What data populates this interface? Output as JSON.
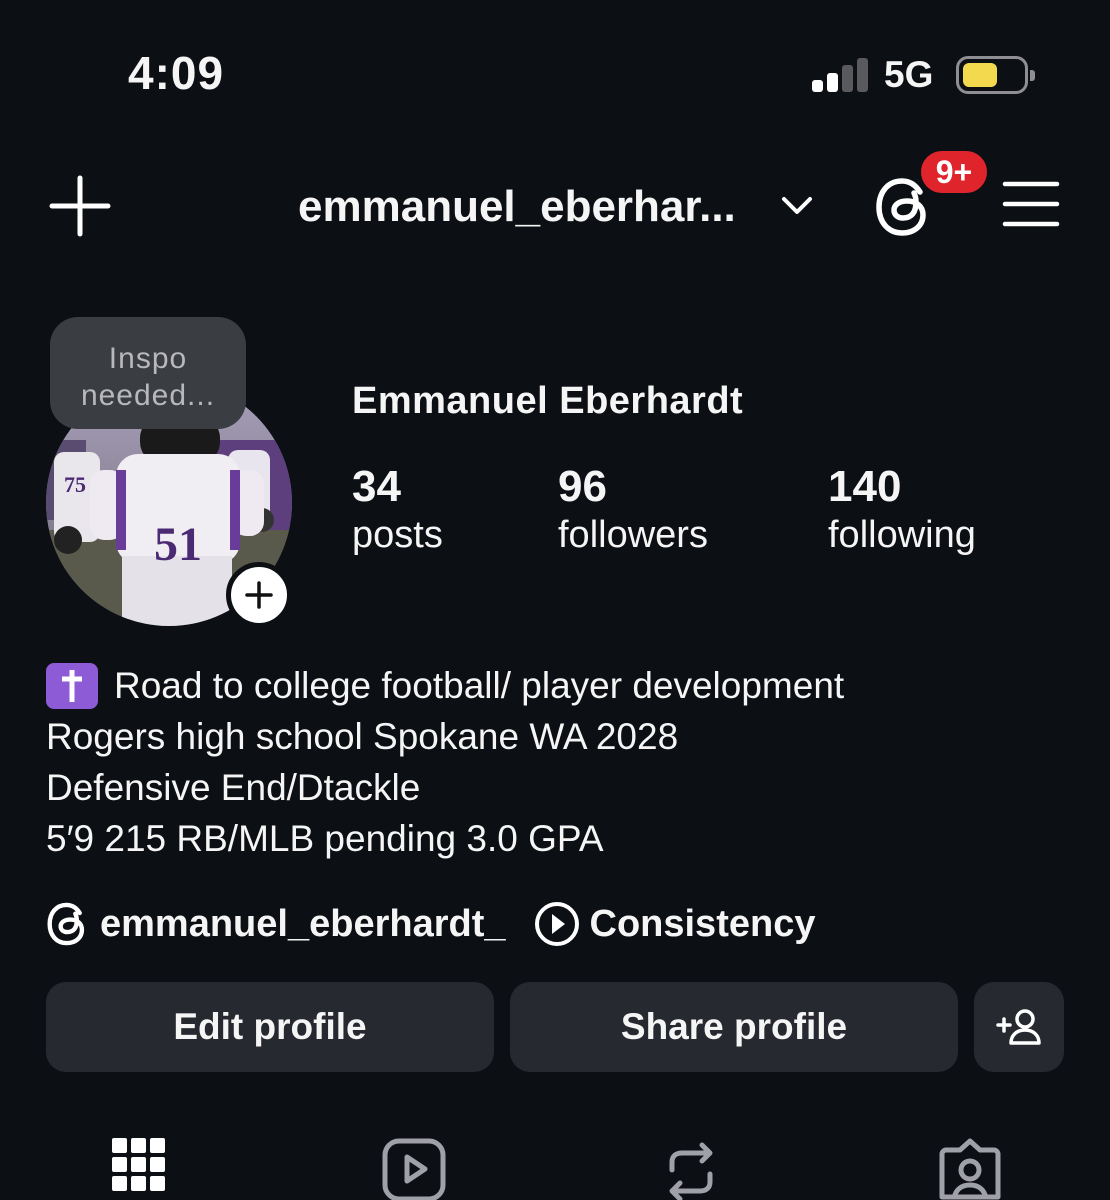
{
  "status_bar": {
    "time": "4:09",
    "network": "5G"
  },
  "header": {
    "username": "emmanuel_eberhar...",
    "notification_badge": "9+"
  },
  "profile": {
    "note": "Inspo needed...",
    "display_name": "Emmanuel Eberhardt",
    "stats": [
      {
        "count": "34",
        "label": "posts"
      },
      {
        "count": "96",
        "label": "followers"
      },
      {
        "count": "140",
        "label": "following"
      }
    ],
    "bio_lines": [
      "Road to college football/ player development",
      "Rogers high school Spokane WA 2028",
      "Defensive End/Dtackle",
      "5′9 215 RB/MLB pending 3.0 GPA"
    ],
    "threads_link": "emmanuel_eberhardt_",
    "link_label": "Consistency"
  },
  "buttons": {
    "edit_profile": "Edit profile",
    "share_profile": "Share profile"
  },
  "icons": {
    "new_post": "plus-icon",
    "threads": "threads-icon",
    "menu": "hamburger-menu-icon",
    "add_person": "add-person-icon",
    "tabs": [
      "grid-icon",
      "reels-icon",
      "reposts-icon",
      "tagged-icon"
    ]
  },
  "colors": {
    "background": "#0c0f14",
    "badge": "#e0242c",
    "battery": "#f2d94e",
    "button": "#262a30",
    "cross": "#8e5bd6"
  }
}
